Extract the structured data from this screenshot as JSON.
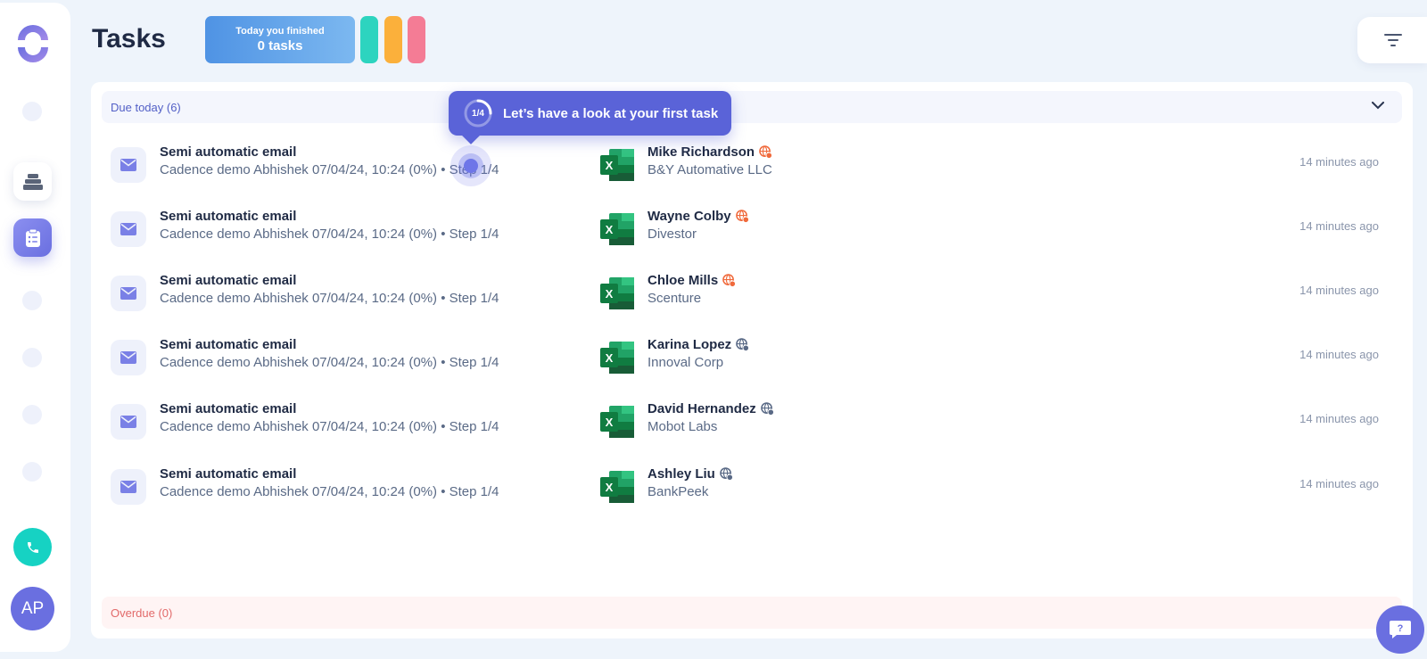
{
  "header": {
    "title": "Tasks",
    "finished_label": "Today you finished",
    "finished_count": "0 tasks"
  },
  "sidebar": {
    "avatar_initials": "AP"
  },
  "sections": {
    "due_today": "Due today (6)",
    "overdue": "Overdue (0)"
  },
  "tooltip": {
    "step": "1/4",
    "text": "Let’s have a look at your first task"
  },
  "tasks": [
    {
      "title": "Semi automatic email",
      "subtitle": "Cadence demo Abhishek 07/04/24, 10:24 (0%) • Step 1/4",
      "contact": "Mike Richardson",
      "company": "B&Y Automative LLC",
      "time": "14 minutes ago",
      "globe_color": "#f06a3c"
    },
    {
      "title": "Semi automatic email",
      "subtitle": "Cadence demo Abhishek 07/04/24, 10:24 (0%) • Step 1/4",
      "contact": "Wayne Colby",
      "company": "Divestor",
      "time": "14 minutes ago",
      "globe_color": "#f06a3c"
    },
    {
      "title": "Semi automatic email",
      "subtitle": "Cadence demo Abhishek 07/04/24, 10:24 (0%) • Step 1/4",
      "contact": "Chloe Mills",
      "company": "Scenture",
      "time": "14 minutes ago",
      "globe_color": "#f06a3c"
    },
    {
      "title": "Semi automatic email",
      "subtitle": "Cadence demo Abhishek 07/04/24, 10:24 (0%) • Step 1/4",
      "contact": "Karina Lopez",
      "company": "Innoval Corp",
      "time": "14 minutes ago",
      "globe_color": "#5a6a86"
    },
    {
      "title": "Semi automatic email",
      "subtitle": "Cadence demo Abhishek 07/04/24, 10:24 (0%) • Step 1/4",
      "contact": "David Hernandez",
      "company": "Mobot Labs",
      "time": "14 minutes ago",
      "globe_color": "#5a6a86"
    },
    {
      "title": "Semi automatic email",
      "subtitle": "Cadence demo Abhishek 07/04/24, 10:24 (0%) • Step 1/4",
      "contact": "Ashley Liu",
      "company": "BankPeek",
      "time": "14 minutes ago",
      "globe_color": "#5a6a86"
    }
  ],
  "colors": {
    "accent": "#6a6fe0",
    "teal": "#2dd4bf",
    "orange": "#fbb03b",
    "pink": "#f47c95"
  }
}
